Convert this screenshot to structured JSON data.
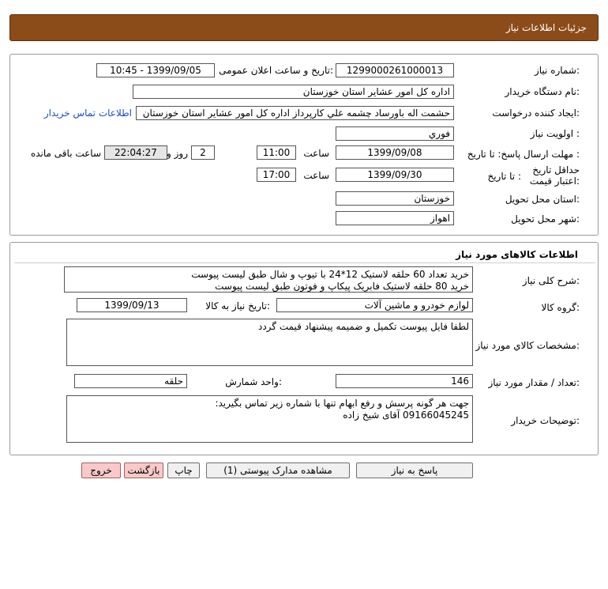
{
  "header": {
    "title": "جزئیات اطلاعات نیاز"
  },
  "fields": {
    "need_number": {
      "label": "شماره نیاز:",
      "value": "1299000261000013"
    },
    "announce_datetime": {
      "label": "تاریخ و ساعت اعلان عمومی:",
      "value": "1399/09/05 - 10:45"
    },
    "buyer_org": {
      "label": "نام دستگاه خریدار:",
      "value": "اداره کل امور عشایر استان خوزستان"
    },
    "requester": {
      "label": "ایجاد کننده درخواست:",
      "value": "حشمت اله باورساد چشمه علي کارپرداز اداره کل امور عشایر استان خوزستان",
      "contact_link": "اطلاعات تماس خریدار"
    },
    "priority": {
      "label": "اولویت نیاز :",
      "value": "فوري"
    },
    "deadline": {
      "label": "مهلت ارسال پاسخ:  تا تاریخ :",
      "date": "1399/09/08",
      "time_label": "ساعت",
      "time": "11:00",
      "days": "2",
      "days_label": "روز و",
      "remaining": "22:04:27",
      "remaining_label": "ساعت باقی مانده"
    },
    "validity": {
      "label": "حداقل تاریخ اعتبار قیمت:",
      "to_date_label": "تا تاریخ :",
      "date": "1399/09/30",
      "time_label": "ساعت",
      "time": "17:00"
    },
    "province": {
      "label": "استان محل تحویل:",
      "value": "خوزستان"
    },
    "city": {
      "label": "شهر محل تحویل:",
      "value": "اهواز"
    }
  },
  "goods": {
    "section_title": "اطلاعات کالاهای مورد نیاز",
    "description_label": "شرح کلی نیاز:",
    "description_lines": [
      "خرید تعداد 60 حلقه لاستیک 12*24 با تیوپ و شال طبق لیست پیوست",
      "خرید 80 حلقه لاستیک فابریک پیکاپ و فوتون طبق لیست پیوست"
    ],
    "group_label": "گروه کالا:",
    "group_value": "لوازم خودرو و ماشین آلات",
    "need_date_label": "تاریخ نیاز به کالا:",
    "need_date": "1399/09/13",
    "specs_label": "مشخصات کالاي مورد نیاز:",
    "specs_value": "لطفا فایل پیوست تکمیل و ضمیمه پیشنهاد قیمت گردد",
    "quantity_label": "تعداد / مقدار مورد نیاز:",
    "quantity": "146",
    "unit_label": "واحد شمارش:",
    "unit": "حلقه",
    "buyer_notes_label": "توضیحات خریدار:",
    "buyer_notes_lines": [
      "جهت هر گونه پرسش و رفع ابهام تنها با شماره زیر تماس بگیرید:",
      "09166045245 آقای شیخ زاده"
    ]
  },
  "buttons": {
    "reply": "پاسخ به نیاز",
    "attachments": "مشاهده مدارک پیوستی (1)",
    "print": "چاپ",
    "back": "بازگشت",
    "exit": "خروج"
  }
}
